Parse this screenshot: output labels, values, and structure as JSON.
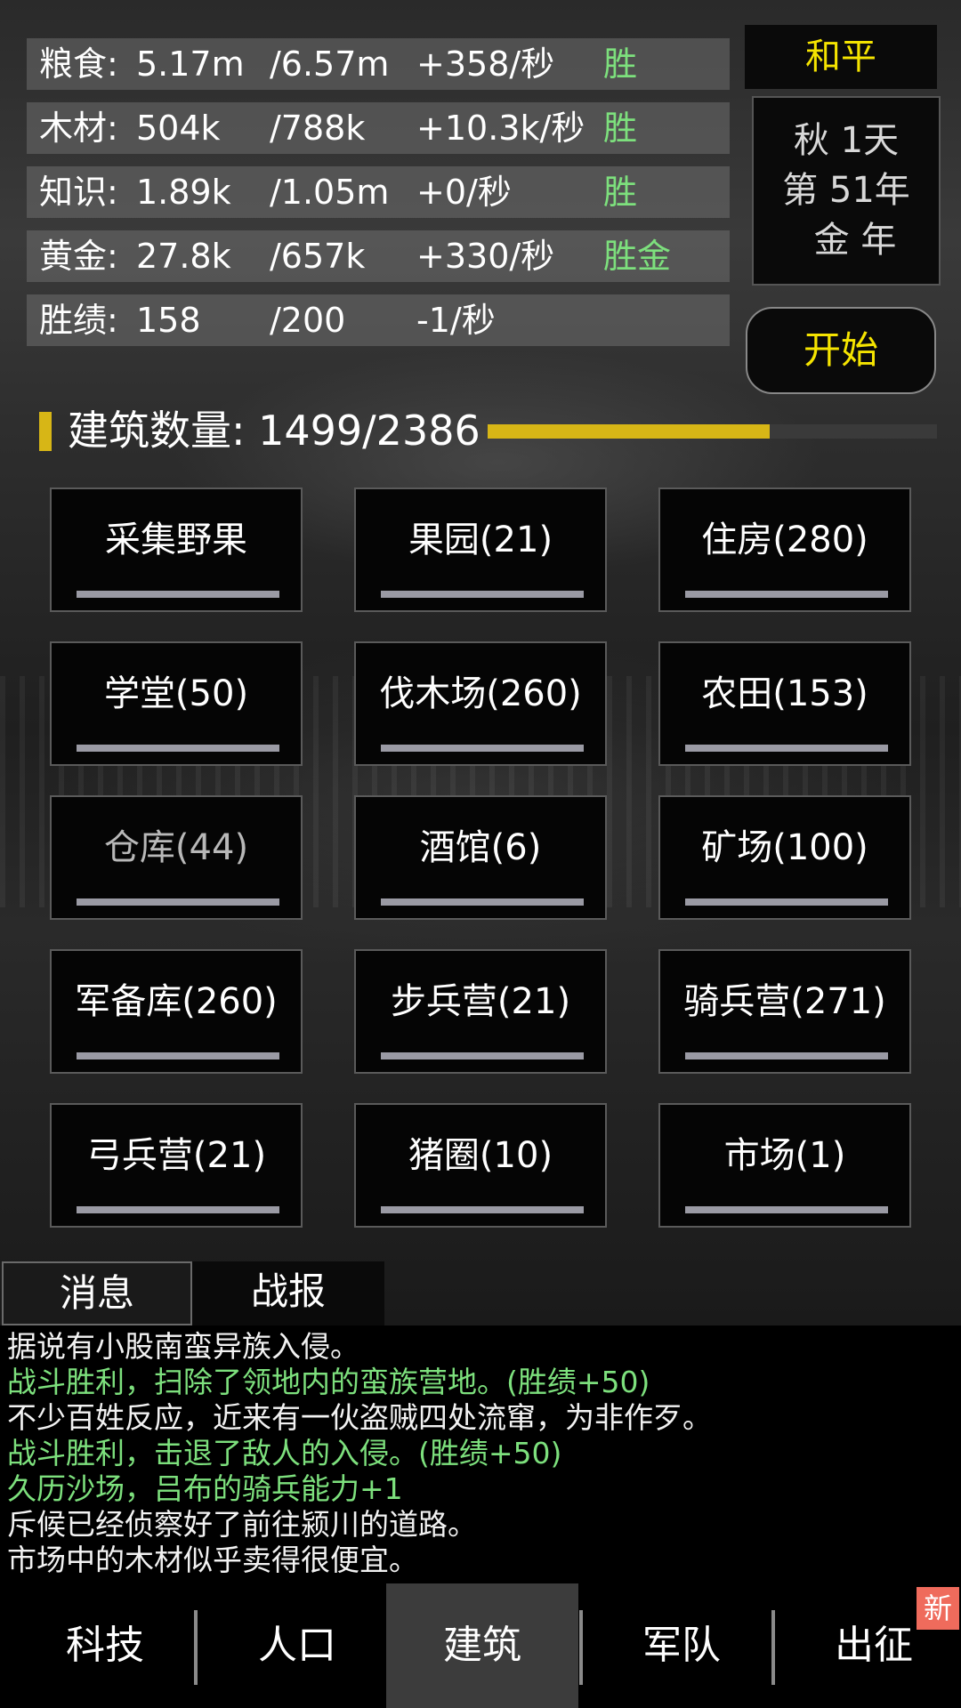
{
  "resources": [
    {
      "name": "粮食:",
      "current": "5.17m",
      "max": "/6.57m",
      "rate": "+358/秒",
      "mark": "胜"
    },
    {
      "name": "木材:",
      "current": "504k",
      "max": "/788k",
      "rate": "+10.3k/秒",
      "mark": "胜"
    },
    {
      "name": "知识:",
      "current": "1.89k",
      "max": "/1.05m",
      "rate": "+0/秒",
      "mark": "胜"
    },
    {
      "name": "黄金:",
      "current": "27.8k",
      "max": "/657k",
      "rate": "+330/秒",
      "mark": "胜金"
    },
    {
      "name": "胜绩:",
      "current": "158",
      "max": "/200",
      "rate": "-1/秒",
      "mark": ""
    }
  ],
  "status": {
    "mode": "和平",
    "date_lines": [
      "秋 1天",
      "第 51年",
      "金 年"
    ],
    "start_label": "开始"
  },
  "buildings_summary": {
    "label": "建筑数量: 1499/2386",
    "progress_fraction": 0.628
  },
  "buildings": [
    {
      "label": "采集野果"
    },
    {
      "label": "果园(21)"
    },
    {
      "label": "住房(280)"
    },
    {
      "label": "学堂(50)"
    },
    {
      "label": "伐木场(260)"
    },
    {
      "label": "农田(153)"
    },
    {
      "label": "仓库(44)"
    },
    {
      "label": "酒馆(6)"
    },
    {
      "label": "矿场(100)"
    },
    {
      "label": "军备库(260)"
    },
    {
      "label": "步兵营(21)"
    },
    {
      "label": "骑兵营(271)"
    },
    {
      "label": "弓兵营(21)"
    },
    {
      "label": "猪圈(10)"
    },
    {
      "label": "市场(1)"
    }
  ],
  "tabs": {
    "messages": "消息",
    "battle_report": "战报"
  },
  "log": [
    {
      "text": "据说有小股南蛮异族入侵。",
      "type": "normal"
    },
    {
      "text": "战斗胜利，扫除了领地内的蛮族营地。(胜绩+50)",
      "type": "success"
    },
    {
      "text": "不少百姓反应，近来有一伙盗贼四处流窜，为非作歹。",
      "type": "normal"
    },
    {
      "text": "战斗胜利，击退了敌人的入侵。(胜绩+50)",
      "type": "success"
    },
    {
      "text": "久历沙场，吕布的骑兵能力+1",
      "type": "success"
    },
    {
      "text": "斥候已经侦察好了前往颍川的道路。",
      "type": "normal"
    },
    {
      "text": "市场中的木材似乎卖得很便宜。",
      "type": "normal"
    }
  ],
  "nav": {
    "tech": "科技",
    "population": "人口",
    "buildings": "建筑",
    "army": "军队",
    "expedition": "出征",
    "new_badge": "新"
  },
  "colors": {
    "accent_yellow": "#f5e400",
    "bar_gold": "#d7b616",
    "success_green": "#7de07d",
    "badge_red": "#ef6b5c"
  }
}
